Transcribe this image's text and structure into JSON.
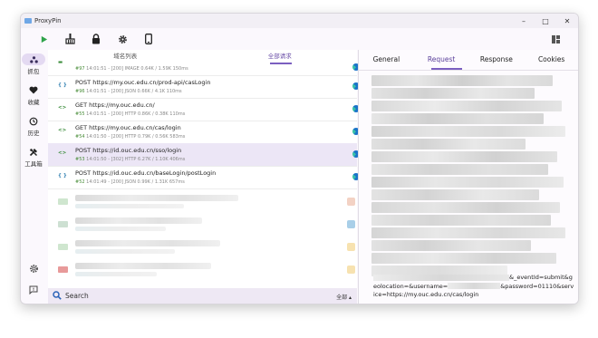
{
  "window": {
    "title": "ProxyPin",
    "minimize": "–",
    "maximize": "□",
    "close": "✕"
  },
  "toolbar": {
    "icons": [
      "play-icon",
      "broom-icon",
      "lock-icon",
      "gear-icon",
      "phone-icon"
    ],
    "layout_icon": "layout-icon"
  },
  "sidebar": {
    "items": [
      {
        "label": "抓包",
        "icon": "capture-icon"
      },
      {
        "label": "收藏",
        "icon": "heart-icon"
      },
      {
        "label": "历史",
        "icon": "history-icon"
      },
      {
        "label": "工具箱",
        "icon": "tools-icon"
      }
    ],
    "settings_icon": "settings-icon",
    "feedback_icon": "feedback-icon"
  },
  "left_tabs": [
    "域名列表",
    "全部请求"
  ],
  "requests": [
    {
      "marker": "▬",
      "line1": "",
      "num": "#97",
      "line2": "14:01:51 - [200] IMAGE 0.64K / 1.59K 150ms"
    },
    {
      "marker": "{ }",
      "line1": "POST https://my.ouc.edu.cn/prod-api/casLogin",
      "num": "#96",
      "line2": "14:01:51 - [200] JSON 0.66K / 4.1K 110ms"
    },
    {
      "marker": "<>",
      "line1": "GET https://my.ouc.edu.cn/",
      "num": "#55",
      "line2": "14:01:51 - [200] HTTP 0.86K / 0.38K 110ms"
    },
    {
      "marker": "<>",
      "line1": "GET https://my.ouc.edu.cn/cas/login",
      "num": "#54",
      "line2": "14:01:50 - [200] HTTP 0.79K / 0.56K 583ms"
    },
    {
      "marker": "<>",
      "line1": "POST https://id.ouc.edu.cn/sso/login",
      "num": "#53",
      "line2": "14:01:50 - [302] HTTP 6.27K / 1.10K 406ms"
    },
    {
      "marker": "{ }",
      "line1": "POST https://id.ouc.edu.cn/baseLogin/postLogin",
      "num": "#52",
      "line2": "14:01:49 - [200] JSON 0.99K / 1.31K 657ms"
    }
  ],
  "search": {
    "placeholder": "Search",
    "filter": "全部 ▴"
  },
  "right_tabs": [
    "General",
    "Request",
    "Response",
    "Cookies"
  ],
  "request_body": {
    "part1": "&_e",
    "part2": "ventId=submit&geolocation=&username=",
    "part3": "&password=",
    "part4": "01110&service=https://my.ouc.edu.cn/cas/login"
  }
}
